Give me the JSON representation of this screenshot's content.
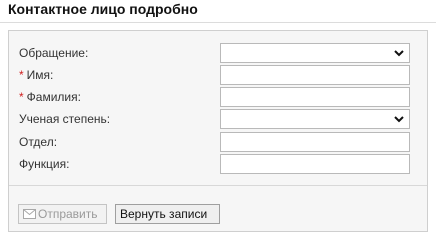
{
  "header": {
    "title": "Контактное лицо подробно"
  },
  "form": {
    "fields": [
      {
        "label": "Обращение:",
        "required": false,
        "type": "select",
        "value": ""
      },
      {
        "label": "Имя:",
        "required": true,
        "type": "text",
        "value": ""
      },
      {
        "label": "Фамилия:",
        "required": true,
        "type": "text",
        "value": ""
      },
      {
        "label": "Ученая степень:",
        "required": false,
        "type": "select",
        "value": ""
      },
      {
        "label": "Отдел:",
        "required": false,
        "type": "text",
        "value": ""
      },
      {
        "label": "Функция:",
        "required": false,
        "type": "text",
        "value": ""
      }
    ],
    "required_mark": "*"
  },
  "actions": {
    "send_label": "Отправить",
    "send_icon": "envelope-icon",
    "send_disabled": true,
    "back_label": "Вернуть записи"
  },
  "colors": {
    "required_mark": "#d02020",
    "panel_background": "#f6f6f6",
    "disabled_text": "#9a9a9a"
  }
}
